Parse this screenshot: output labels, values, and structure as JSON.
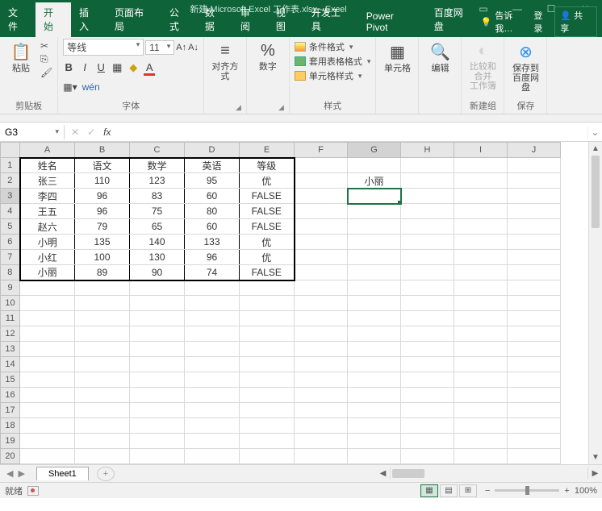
{
  "titlebar": {
    "title": "新建 Microsoft Excel 工作表.xlsx - Excel"
  },
  "tabs": {
    "file": "文件",
    "home": "开始",
    "insert": "插入",
    "page": "页面布局",
    "formulas": "公式",
    "data": "数据",
    "review": "审阅",
    "view": "视图",
    "dev": "开发工具",
    "power": "Power Pivot",
    "baidu": "百度网盘",
    "tell": "告诉我…",
    "login": "登录",
    "share": "共享"
  },
  "ribbon": {
    "clipboard": {
      "paste": "粘贴",
      "label": "剪贴板"
    },
    "font": {
      "name": "等线",
      "size": "11",
      "label": "字体"
    },
    "align": {
      "label": "对齐方式"
    },
    "number": {
      "label": "数字"
    },
    "styles": {
      "cond": "条件格式",
      "tbl": "套用表格格式",
      "cell": "单元格样式",
      "label": "样式"
    },
    "cells": {
      "label": "单元格"
    },
    "editing": {
      "label": "编辑"
    },
    "newgroup": {
      "compare": "比较和合并",
      "workbook": "工作簿",
      "label": "新建组"
    },
    "save": {
      "saveto": "保存到",
      "baidu": "百度网盘",
      "label": "保存"
    }
  },
  "formula_bar": {
    "cell_ref": "G3",
    "formula": ""
  },
  "columns": [
    "A",
    "B",
    "C",
    "D",
    "E",
    "F",
    "G",
    "H",
    "I",
    "J"
  ],
  "row_count": 20,
  "table": {
    "rows": [
      [
        "姓名",
        "语文",
        "数学",
        "英语",
        "等级"
      ],
      [
        "张三",
        "110",
        "123",
        "95",
        "优"
      ],
      [
        "李四",
        "96",
        "83",
        "60",
        "FALSE"
      ],
      [
        "王五",
        "96",
        "75",
        "80",
        "FALSE"
      ],
      [
        "赵六",
        "79",
        "65",
        "60",
        "FALSE"
      ],
      [
        "小明",
        "135",
        "140",
        "133",
        "优"
      ],
      [
        "小红",
        "100",
        "130",
        "96",
        "优"
      ],
      [
        "小丽",
        "89",
        "90",
        "74",
        "FALSE"
      ]
    ]
  },
  "extra": {
    "g2": "小丽"
  },
  "selected_cell": "G3",
  "sheet": {
    "name": "Sheet1"
  },
  "status": {
    "ready": "就绪",
    "zoom": "100%"
  }
}
